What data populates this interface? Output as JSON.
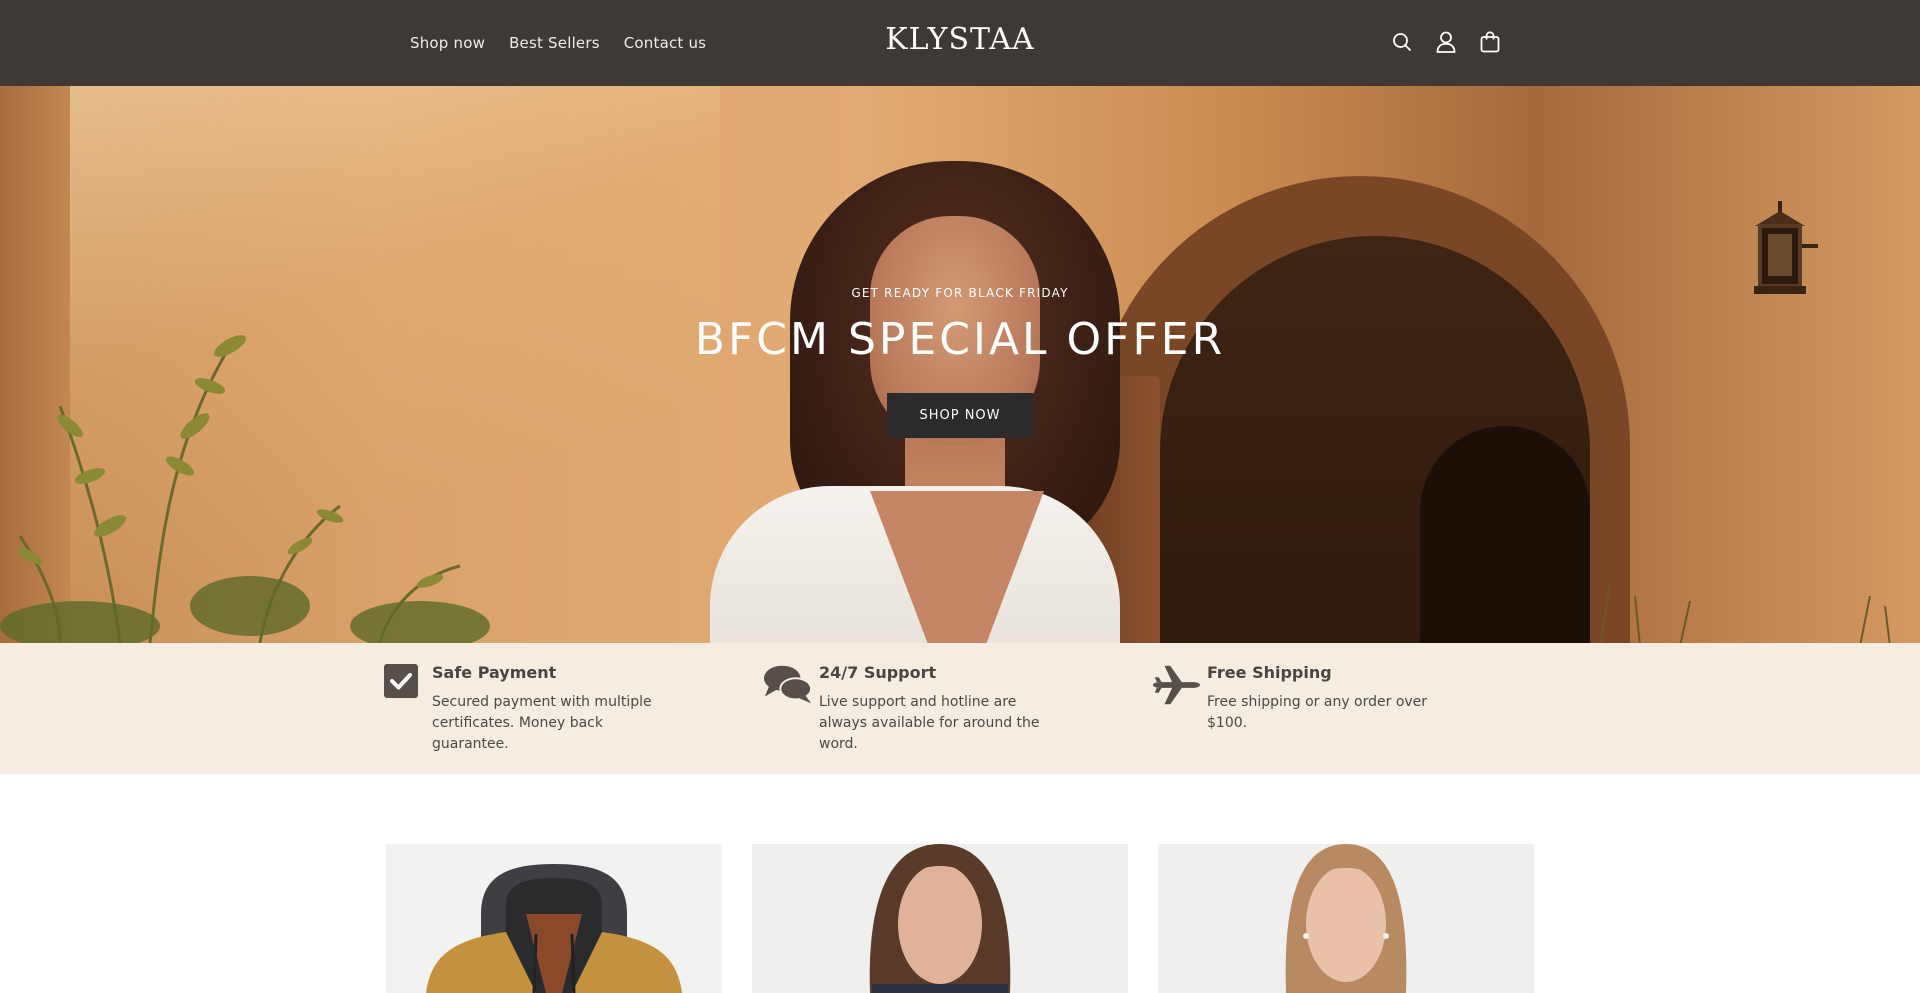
{
  "header": {
    "nav": [
      "Shop now",
      "Best Sellers",
      "Contact us"
    ],
    "logo": "KLYSTAA",
    "icons": [
      "search-icon",
      "account-icon",
      "cart-icon"
    ],
    "background": "#3e3937"
  },
  "hero": {
    "kicker": "GET READY FOR BLACK FRIDAY",
    "title": "BFCM SPECIAL OFFER",
    "button": "SHOP NOW"
  },
  "features": [
    {
      "icon": "check-square-icon",
      "title": "Safe Payment",
      "desc": "Secured payment with multiple certificates. Money back guarantee."
    },
    {
      "icon": "chat-bubbles-icon",
      "title": "24/7 Support",
      "desc": "Live support and hotline are always available for around the word."
    },
    {
      "icon": "airplane-icon",
      "title": "Free Shipping",
      "desc": "Free shipping or any order over $100."
    }
  ],
  "colors": {
    "features_bg": "#f5ede1",
    "icon_color": "#57504a",
    "button_bg": "#2b2b2b"
  }
}
